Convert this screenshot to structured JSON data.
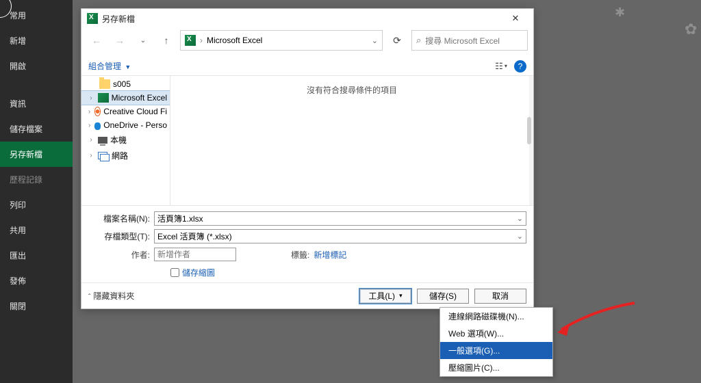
{
  "sidebar": {
    "items": [
      {
        "label": "常用"
      },
      {
        "label": "新增"
      },
      {
        "label": "開啟"
      },
      {
        "label": "資訊"
      },
      {
        "label": "儲存檔案"
      },
      {
        "label": "另存新檔"
      },
      {
        "label": "歷程記錄"
      },
      {
        "label": "列印"
      },
      {
        "label": "共用"
      },
      {
        "label": "匯出"
      },
      {
        "label": "發佈"
      },
      {
        "label": "關閉"
      }
    ]
  },
  "dialog": {
    "title": "另存新檔",
    "breadcrumb": "Microsoft Excel",
    "search_placeholder": "搜尋 Microsoft Excel",
    "organize": "組合管理",
    "tree": [
      {
        "label": "s005",
        "icon": "folder",
        "expander": ""
      },
      {
        "label": "Microsoft Excel",
        "icon": "excel",
        "expander": "›",
        "selected": true
      },
      {
        "label": "Creative Cloud Fi",
        "icon": "cc",
        "expander": "›"
      },
      {
        "label": "OneDrive - Perso",
        "icon": "onedrive",
        "expander": "›"
      },
      {
        "label": "本機",
        "icon": "pc",
        "expander": "›"
      },
      {
        "label": "網路",
        "icon": "net",
        "expander": "›"
      }
    ],
    "empty_text": "沒有符合搜尋條件的項目",
    "filename_label": "檔案名稱(N):",
    "filename_value": "活頁簿1.xlsx",
    "filetype_label": "存檔類型(T):",
    "filetype_value": "Excel 活頁簿 (*.xlsx)",
    "author_label": "作者:",
    "author_placeholder": "新增作者",
    "tags_label": "標籤:",
    "tags_link": "新增標記",
    "thumbnail_label": "儲存縮圖",
    "hide_folders": "隱藏資料夾",
    "tools_btn": "工具(L)",
    "save_btn": "儲存(S)",
    "cancel_btn": "取消",
    "tools_menu": [
      {
        "label": "連線網路磁碟機(N)..."
      },
      {
        "label": "Web 選項(W)..."
      },
      {
        "label": "一般選項(G)...",
        "hover": true
      },
      {
        "label": "壓縮圖片(C)..."
      }
    ]
  }
}
